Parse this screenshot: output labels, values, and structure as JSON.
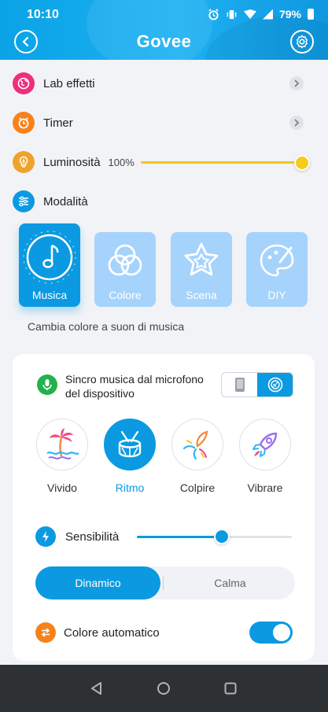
{
  "status_bar": {
    "time": "10:10",
    "battery": "79%"
  },
  "header": {
    "logo": "Govee"
  },
  "menu": {
    "lab": {
      "label": "Lab effetti"
    },
    "timer": {
      "label": "Timer"
    },
    "brightness": {
      "label": "Luminosità",
      "value_text": "100%",
      "value": 100
    },
    "mode": {
      "label": "Modalità"
    }
  },
  "modes": [
    {
      "label": "Musica",
      "icon": "music-note-icon",
      "selected": true
    },
    {
      "label": "Colore",
      "icon": "color-circles-icon",
      "selected": false
    },
    {
      "label": "Scena",
      "icon": "star-icon",
      "selected": false
    },
    {
      "label": "DIY",
      "icon": "palette-icon",
      "selected": false
    }
  ],
  "mode_description": "Cambia colore a suon di musica",
  "music_card": {
    "mic_sync_label": "Sincro musica dal microfono del dispositivo",
    "source_options": [
      {
        "icon": "phone-icon",
        "selected": false
      },
      {
        "icon": "device-speaker-icon",
        "selected": true
      }
    ],
    "effects": [
      {
        "label": "Vivido",
        "icon": "palm-beach-icon",
        "selected": false
      },
      {
        "label": "Ritmo",
        "icon": "drum-icon",
        "selected": true
      },
      {
        "label": "Colpire",
        "icon": "firework-icon",
        "selected": false
      },
      {
        "label": "Vibrare",
        "icon": "rocket-icon",
        "selected": false
      }
    ],
    "sensitivity": {
      "label": "Sensibilità",
      "value": 0.55
    },
    "modes": {
      "dynamic": "Dinamico",
      "calm": "Calma",
      "selected": "Dinamico"
    },
    "auto_color": {
      "label": "Colore automatico",
      "enabled": true
    }
  },
  "colors": {
    "accent": "#0b9ae1",
    "brightness": "#f4c51b"
  }
}
